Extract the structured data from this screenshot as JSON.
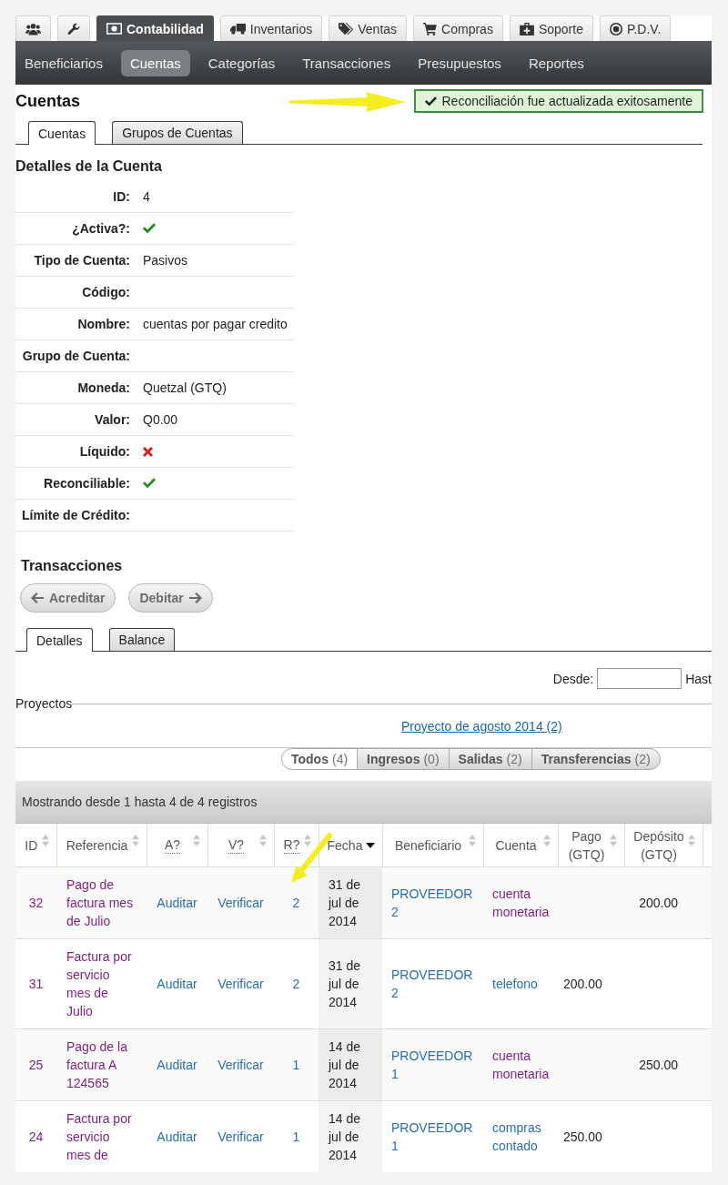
{
  "top_tabs": [
    {
      "selected": false
    },
    {
      "selected": false
    },
    {
      "label": "Contabilidad",
      "selected": true
    },
    {
      "label": "Inventarios",
      "selected": false
    },
    {
      "label": "Ventas",
      "selected": false
    },
    {
      "label": "Compras",
      "selected": false
    },
    {
      "label": "Soporte",
      "selected": false
    },
    {
      "label": "P.D.V.",
      "selected": false
    }
  ],
  "sub_nav": [
    {
      "label": "Beneficiarios",
      "selected": false
    },
    {
      "label": "Cuentas",
      "selected": true
    },
    {
      "label": "Categorías",
      "selected": false
    },
    {
      "label": "Transacciones",
      "selected": false
    },
    {
      "label": "Presupuestos",
      "selected": false
    },
    {
      "label": "Reportes",
      "selected": false
    }
  ],
  "page_title": "Cuentas",
  "alert": {
    "message": "Reconciliación fue actualizada exitosamente"
  },
  "account_tabs": [
    {
      "label": "Cuentas",
      "selected": true
    },
    {
      "label": "Grupos de Cuentas",
      "selected": false
    }
  ],
  "details": {
    "title": "Detalles de la Cuenta",
    "rows": [
      {
        "label": "ID:",
        "kind": "text",
        "value": "4"
      },
      {
        "label": "¿Activa?:",
        "kind": "flag",
        "value": true
      },
      {
        "label": "Tipo de Cuenta:",
        "kind": "text",
        "value": "Pasivos"
      },
      {
        "label": "Código:",
        "kind": "text"
      },
      {
        "label": "Nombre:",
        "kind": "text",
        "value": "cuentas por pagar credito"
      },
      {
        "label": "Grupo de Cuenta:",
        "kind": "text"
      },
      {
        "label": "Moneda:",
        "kind": "text",
        "value": "Quetzal (GTQ)"
      },
      {
        "label": "Valor:",
        "kind": "text",
        "value": "Q0.00"
      },
      {
        "label": "Líquido:",
        "kind": "flag",
        "value": false
      },
      {
        "label": "Reconciliable:",
        "kind": "flag",
        "value": true
      },
      {
        "label": "Límite de Crédito:",
        "kind": "text"
      }
    ]
  },
  "transactions": {
    "title": "Transacciones",
    "buttons": [
      {
        "label": "Acreditar"
      },
      {
        "label": "Debitar"
      }
    ],
    "tabs": [
      {
        "label": "Detalles",
        "selected": true
      },
      {
        "label": "Balance",
        "selected": false
      }
    ],
    "date_filter": {
      "from_label": "Desde:",
      "to_label": "Hast"
    },
    "projects": {
      "legend": "Proyectos",
      "items": [
        "Proyecto de agosto 2014 (2)"
      ]
    },
    "filters": [
      {
        "label": "Todos",
        "count": "(4)",
        "selected": true
      },
      {
        "label": "Ingresos",
        "count": "(0)",
        "selected": false
      },
      {
        "label": "Salidas",
        "count": "(2)",
        "selected": false
      },
      {
        "label": "Transferencias",
        "count": "(2)",
        "selected": false
      }
    ],
    "table": {
      "info": "Mostrando desde 1 hasta 4 de 4 registros",
      "columns": [
        {
          "label": "ID",
          "sorted": false,
          "abbr": false
        },
        {
          "label": "Referencia",
          "sorted": false,
          "abbr": false
        },
        {
          "label": "A?",
          "sorted": false,
          "abbr": true
        },
        {
          "label": "V?",
          "sorted": false,
          "abbr": true
        },
        {
          "label": "R?",
          "sorted": false,
          "abbr": true
        },
        {
          "label": "Fecha",
          "sorted": true,
          "abbr": false
        },
        {
          "label": "Beneficiario",
          "sorted": false,
          "abbr": false
        },
        {
          "label": "Cuenta",
          "sorted": false,
          "abbr": false
        },
        {
          "label": "Pago (GTQ)",
          "sorted": false,
          "abbr": false
        },
        {
          "label": "Depósito (GTQ)",
          "sorted": false,
          "abbr": false
        }
      ],
      "rows": [
        {
          "id": {
            "text": "32",
            "visited": true
          },
          "reference": {
            "text": "Pago de factura mes de Julio",
            "visited": true
          },
          "audit": "Auditar",
          "verify": "Verificar",
          "reconciled": "2",
          "date": "31 de jul de 2014",
          "payee": "PROVEEDOR 2",
          "account": {
            "text": "cuenta monetaria",
            "visited": true
          },
          "deposit": "200.00"
        },
        {
          "id": {
            "text": "31",
            "visited": true
          },
          "reference": {
            "text": "Factura por servicio mes de Julio",
            "visited": true
          },
          "audit": "Auditar",
          "verify": "Verificar",
          "reconciled": "2",
          "date": "31 de jul de 2014",
          "payee": "PROVEEDOR 2",
          "account": {
            "text": "telefono",
            "visited": false
          },
          "payment": "200.00"
        },
        {
          "id": {
            "text": "25",
            "visited": true
          },
          "reference": {
            "text": "Pago de la factura A 124565",
            "visited": true
          },
          "audit": "Auditar",
          "verify": "Verificar",
          "reconciled": "1",
          "date": "14 de jul de 2014",
          "payee": "PROVEEDOR 1",
          "account": {
            "text": "cuenta monetaria",
            "visited": true
          },
          "deposit": "250.00"
        },
        {
          "id": {
            "text": "24",
            "visited": true
          },
          "reference": {
            "text": "Factura por servicio mes de",
            "visited": true
          },
          "audit": "Auditar",
          "verify": "Verificar",
          "reconciled": "1",
          "date": "14 de jul de 2014",
          "payee": "PROVEEDOR 1",
          "account": {
            "text": "compras contado",
            "visited": false
          },
          "payment": "250.00"
        }
      ]
    }
  }
}
